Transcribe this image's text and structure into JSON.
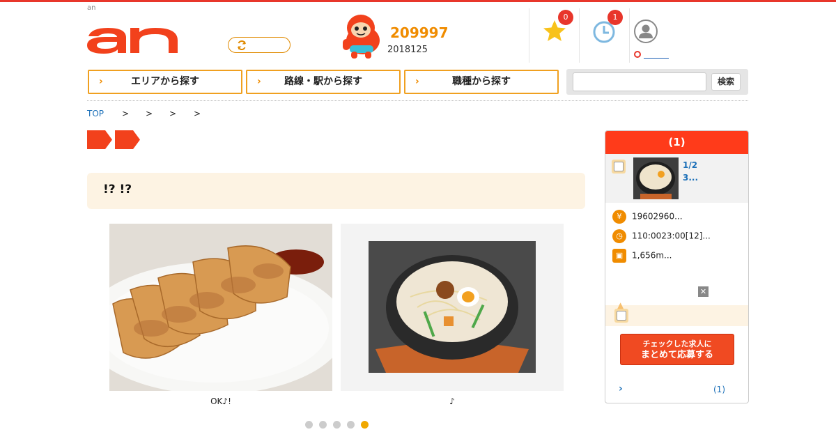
{
  "header": {
    "site_tag": "an",
    "mascot_count_big": "209997",
    "mascot_count_small": "2018125",
    "favorites_badge": "0",
    "history_badge": "1"
  },
  "nav": {
    "area_label": "エリアから探す",
    "route_label": "路線・駅から探す",
    "job_label": "職種から探す",
    "search_placeholder": "",
    "search_button": "検索"
  },
  "breadcrumb": {
    "top": "TOP",
    "separators": [
      ">",
      ">",
      ">",
      ">"
    ]
  },
  "main": {
    "headline": "!? !?",
    "slides": [
      {
        "caption": "OK♪!"
      },
      {
        "caption": "♪"
      }
    ],
    "dots_total": 5,
    "dots_active": 5
  },
  "sidebar": {
    "title": "(1)",
    "job_title_line1": "1/2",
    "job_title_line2": "3...",
    "salary": "19602960...",
    "hours": "110:0023:00[12]...",
    "access": "1,656m...",
    "apply_line1": "チェックした求人に",
    "apply_line2": "まとめて応募する",
    "footer_count": "(1)"
  },
  "colors": {
    "brand": "#e8362b",
    "accent_orange": "#f08c00",
    "link_blue": "#1a6fb8"
  }
}
